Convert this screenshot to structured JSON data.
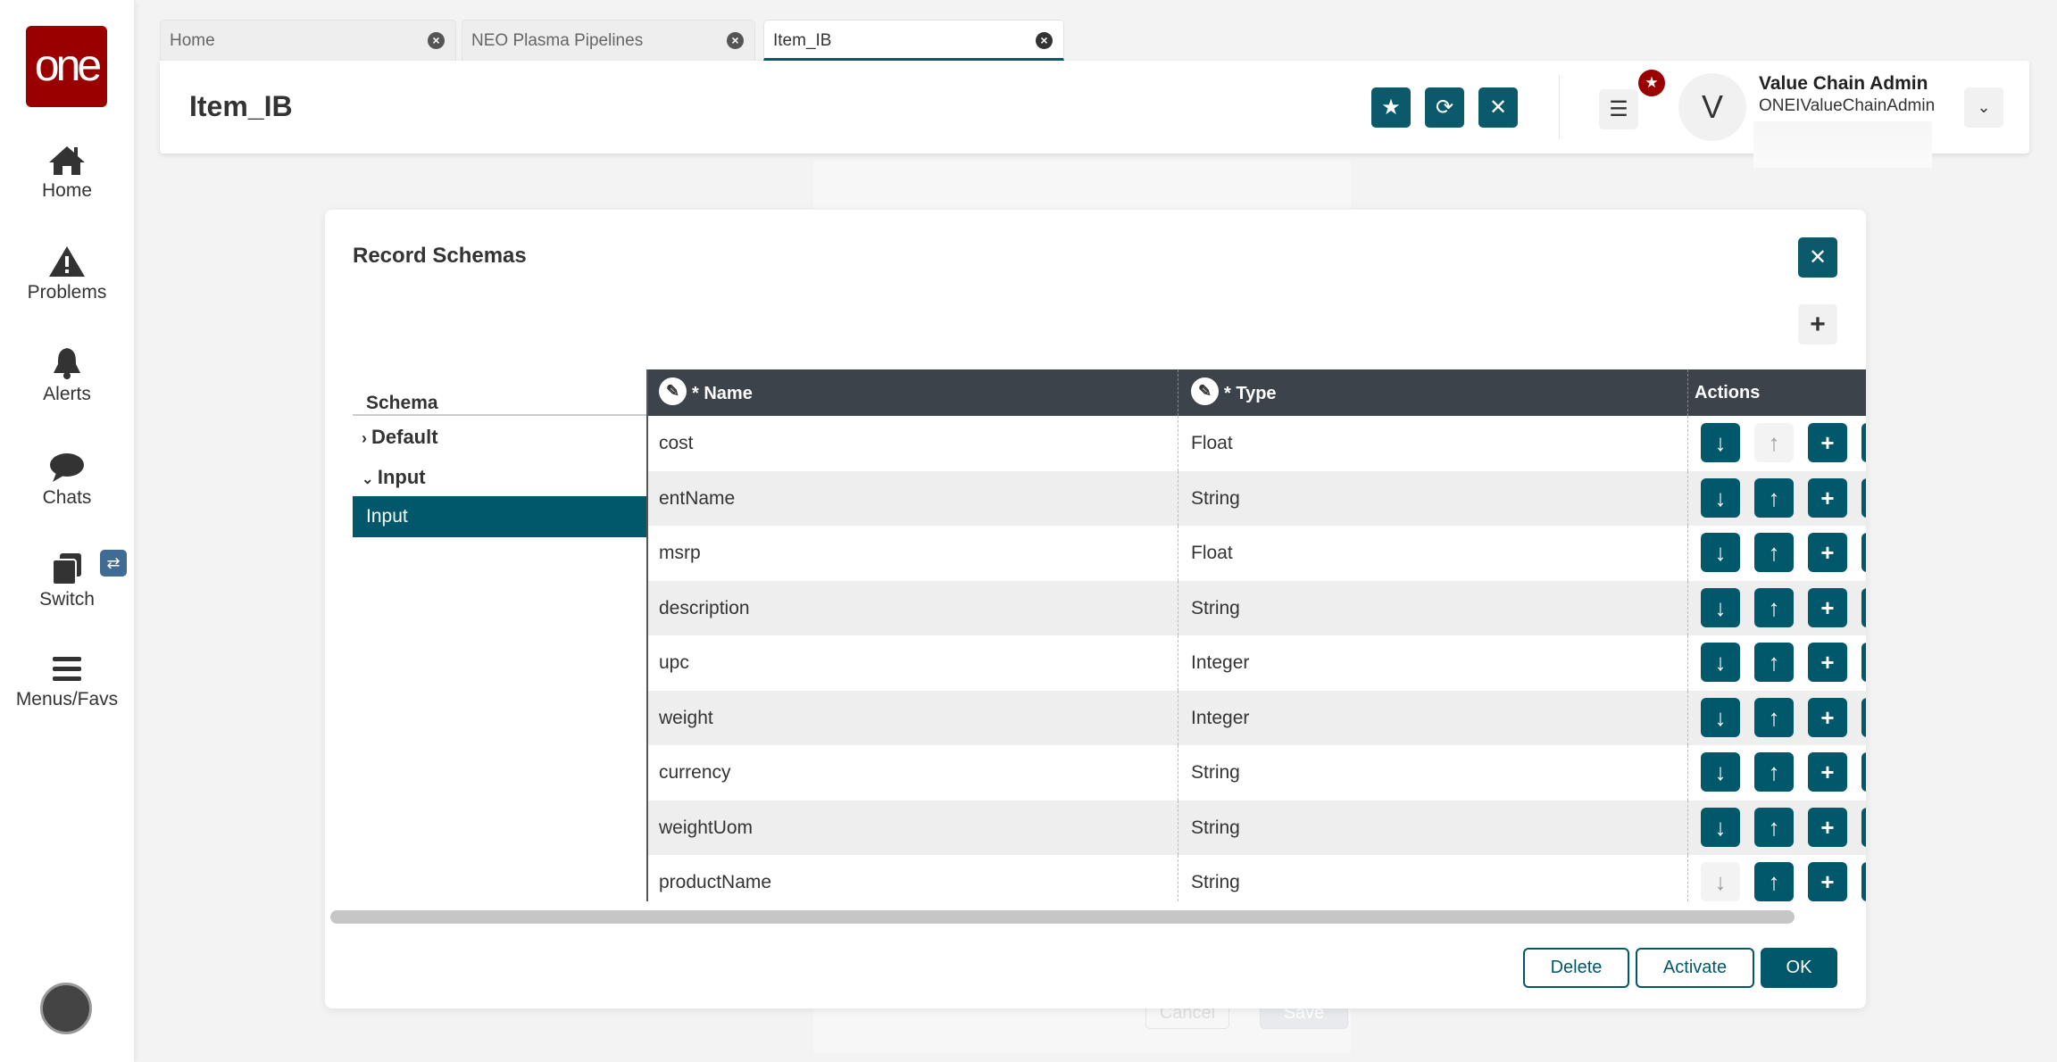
{
  "sidebar": {
    "logo": "one",
    "items": [
      {
        "label": "Home",
        "icon": "home-icon"
      },
      {
        "label": "Problems",
        "icon": "warning-icon"
      },
      {
        "label": "Alerts",
        "icon": "bell-icon"
      },
      {
        "label": "Chats",
        "icon": "chat-icon"
      },
      {
        "label": "Switch",
        "icon": "switch-icon"
      },
      {
        "label": "Menus/Favs",
        "icon": "menu-icon"
      }
    ]
  },
  "tabs": [
    {
      "label": "Home"
    },
    {
      "label": "NEO Plasma Pipelines"
    },
    {
      "label": "Item_IB",
      "active": true
    }
  ],
  "header": {
    "title": "Item_IB",
    "user_name": "Value Chain Admin",
    "user_login": "ONEIValueChainAdmin",
    "avatar_letter": "V"
  },
  "background": {
    "cancel": "Cancel",
    "save": "Save"
  },
  "modal": {
    "title": "Record Schemas",
    "tree": {
      "header": "Schema",
      "nodes": [
        "Default",
        "Input"
      ],
      "selected": "Input"
    },
    "columns": [
      "* Name",
      "* Type",
      "Actions"
    ],
    "rows": [
      {
        "name": "cost",
        "type": "Float"
      },
      {
        "name": "entName",
        "type": "String"
      },
      {
        "name": "msrp",
        "type": "Float"
      },
      {
        "name": "description",
        "type": "String"
      },
      {
        "name": "upc",
        "type": "Integer"
      },
      {
        "name": "weight",
        "type": "Integer"
      },
      {
        "name": "currency",
        "type": "String"
      },
      {
        "name": "weightUom",
        "type": "String"
      },
      {
        "name": "productName",
        "type": "String"
      }
    ],
    "buttons": {
      "delete": "Delete",
      "activate": "Activate",
      "ok": "OK"
    }
  },
  "colors": {
    "primary": "#02586b",
    "logo": "#9b0000",
    "grid_header": "#3d434b"
  }
}
